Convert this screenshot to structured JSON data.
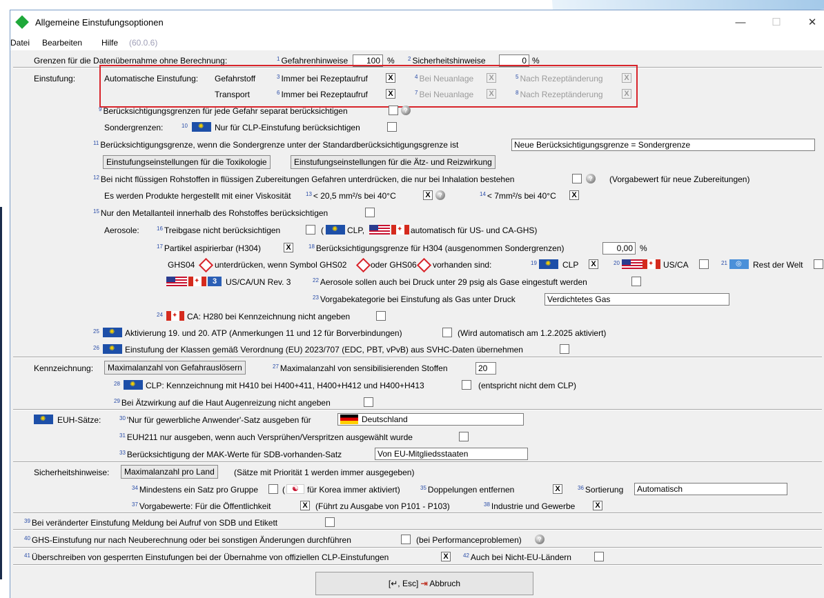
{
  "window": {
    "title": "Allgemeine Einstufungsoptionen",
    "minimize": "—",
    "maximize": "☐",
    "close": "✕"
  },
  "menu": {
    "datei": "Datei",
    "bearbeiten": "Bearbeiten",
    "hilfe": "Hilfe",
    "version": "(60.0.6)"
  },
  "grenzen": {
    "label": "Grenzen für die Datenübernahme ohne Berechnung:",
    "n1": "1",
    "gefahr_label": "Gefahrenhinweise",
    "gefahr_value": "100",
    "pct1": "%",
    "n2": "2",
    "sicher_label": "Sicherheitshinweise",
    "sicher_value": "0",
    "pct2": "%"
  },
  "einstufung": {
    "label": "Einstufung:",
    "auto_label": "Automatische Einstufung:",
    "gefahrstoff": "Gefahrstoff",
    "transport": "Transport",
    "n3": "3",
    "immer1": "Immer bei Rezeptaufruf",
    "n4": "4",
    "neu1": "Bei Neuanlage",
    "n5": "5",
    "nach1": "Nach Rezeptänderung",
    "n6": "6",
    "immer2": "Immer bei Rezeptaufruf",
    "n7": "7",
    "neu2": "Bei Neuanlage",
    "n8": "8",
    "nach2": "Nach Rezeptänderung",
    "n9": "9",
    "separat": "Berücksichtigungsgrenzen für jede Gefahr separat berücksichtigen",
    "sonder_label": "Sondergrenzen:",
    "n10": "10",
    "clp_only": "Nur für CLP-Einstufung berücksichtigen",
    "n11": "11",
    "grenze_label": "Berücksichtigungsgrenze, wenn die Sondergrenze unter der Standardberücksichtigungsgrenze ist",
    "grenze_value": "Neue Berücksichtigungsgrenze = Sondergrenze",
    "tox_btn": "Einstufungseinstellungen für die Toxikologie",
    "aetz_btn": "Einstufungseinstellungen für die Ätz- und Reizwirkung",
    "n12": "12",
    "inhalation": "Bei nicht flüssigen Rohstoffen in flüssigen Zubereitungen Gefahren unterdrücken, die nur bei Inhalation bestehen",
    "vorgabe_neu": "(Vorgabewert für neue Zubereitungen)",
    "viskos": "Es werden Produkte hergestellt mit einer Viskosität",
    "n13": "13",
    "visk1": "< 20,5 mm²/s bei 40°C",
    "n14": "14",
    "visk2": "< 7mm²/s bei 40°C",
    "n15": "15",
    "metall": "Nur den Metallanteil innerhalb des Rohstoffes berücksichtigen",
    "aerosole_label": "Aerosole:",
    "n16": "16",
    "treibgase": "Treibgase nicht berücksichtigen",
    "paren_open": "(",
    "clp_comma": "CLP,",
    "auto_us_ca": "automatisch für US- und CA-GHS)",
    "n17": "17",
    "partikel": "Partikel aspirierbar (H304)",
    "n18": "18",
    "h304": "Berücksichtigungsgrenze für H304 (ausgenommen Sondergrenzen)",
    "h304_value": "0,00",
    "pct3": "%",
    "ghs04": "GHS04",
    "unterdr": "unterdrücken, wenn Symbol GHS02",
    "oder": "oder GHS06",
    "vorhanden": "vorhanden sind:",
    "n19": "19",
    "clp19": "CLP",
    "n20": "20",
    "usca20": "US/CA",
    "n21": "21",
    "rest": "Rest der Welt",
    "num3": "3",
    "usca_un": "US/CA/UN Rev. 3",
    "n22": "22",
    "druck29": "Aerosole sollen auch bei Druck unter 29 psig als Gase eingestuft werden",
    "n23": "23",
    "vorgabekat": "Vorgabekategorie bei Einstufung als Gas unter Druck",
    "vorgabekat_value": "Verdichtetes Gas",
    "n24": "24",
    "ca_h280": "CA: H280 bei Kennzeichnung nicht angeben",
    "n25": "25",
    "atp": "Aktivierung 19. und 20. ATP (Anmerkungen 11 und 12 für Borverbindungen)",
    "atp_note": "(Wird automatisch am 1.2.2025 aktiviert)",
    "n26": "26",
    "svhc": "Einstufung der Klassen gemäß Verordnung (EU) 2023/707 (EDC, PBT, vPvB) aus SVHC-Daten übernehmen"
  },
  "kennzeichnung": {
    "label": "Kennzeichnung:",
    "max_btn": "Maximalanzahl von Gefahrauslösern",
    "n27": "27",
    "max_sens": "Maximalanzahl von sensibilisierenden Stoffen",
    "max_sens_value": "20",
    "n28": "28",
    "h410": "CLP: Kennzeichnung mit H410 bei H400+411, H400+H412 und H400+H413",
    "h410_note": "(entspricht nicht dem CLP)",
    "n29": "29",
    "augen": "Bei Ätzwirkung auf die Haut Augenreizung nicht angeben"
  },
  "euh": {
    "label": "EUH-Sätze:",
    "n30": "30",
    "gewerbl": "'Nur für gewerbliche Anwender'-Satz ausgeben für",
    "land": "Deutschland",
    "n31": "31",
    "euh211": "EUH211 nur ausgeben, wenn auch Versprühen/Verspritzen ausgewählt wurde",
    "n33": "33",
    "mak": "Berücksichtigung der MAK-Werte für SDB-vorhanden-Satz",
    "mak_value": "Von EU-Mitgliedsstaaten"
  },
  "sicherheit": {
    "label": "Sicherheitshinweise:",
    "max_btn": "Maximalanzahl pro Land",
    "note": "(Sätze mit Priorität 1 werden immer ausgegeben)",
    "n34": "34",
    "gruppe": "Mindestens ein Satz pro Gruppe",
    "paren_open": "(",
    "korea": "für Korea immer aktiviert)",
    "n35": "35",
    "doppel": "Doppelungen entfernen",
    "n36": "36",
    "sortierung": "Sortierung",
    "sortierung_value": "Automatisch",
    "n37": "37",
    "vorgabe": "Vorgabewerte: Für die Öffentlichkeit",
    "p101": "(Führt zu Ausgabe von P101 - P103)",
    "n38": "38",
    "industrie": "Industrie und Gewerbe"
  },
  "bottom": {
    "n39": "39",
    "meldung": "Bei veränderter Einstufung Meldung bei Aufruf von SDB und Etikett",
    "n40": "40",
    "ghs_neu": "GHS-Einstufung nur nach Neuberechnung oder bei sonstigen Änderungen durchführen",
    "perf": "(bei Performanceproblemen)",
    "n41": "41",
    "ueberschreiben": "Überschreiben von gesperrten Einstufungen bei der Übernahme von offiziellen CLP-Einstufungen",
    "n42": "42",
    "nicht_eu": "Auch bei Nicht-EU-Ländern"
  },
  "footer": {
    "ok": "[↵, Esc]",
    "abbruch": "Abbruch"
  },
  "checks": {
    "checked": "X",
    "unchecked": "",
    "help": "?"
  }
}
